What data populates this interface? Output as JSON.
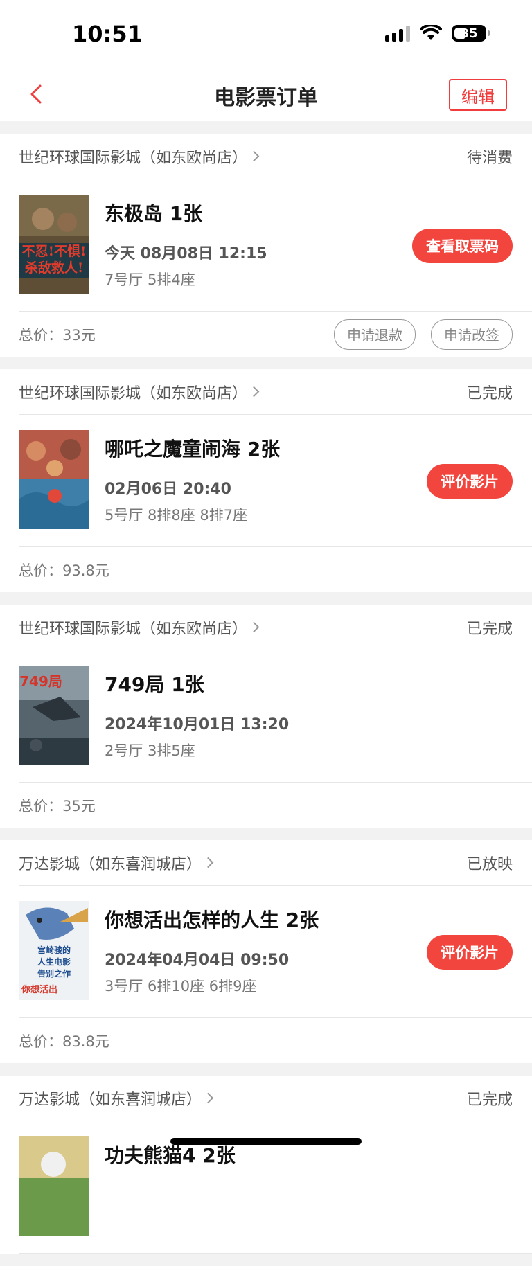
{
  "status_bar": {
    "time": "10:51",
    "battery": "35"
  },
  "nav": {
    "title": "电影票订单",
    "edit_label": "编辑"
  },
  "orders": [
    {
      "cinema": "世纪环球国际影城（如东欧尚店）",
      "status": "待消费",
      "movie": "东极岛 1张",
      "time": "今天 08月08日 12:15",
      "seats": "7号厅 5排4座",
      "action": "查看取票码",
      "total": "总价：33元",
      "refund_label": "申请退款",
      "change_label": "申请改签",
      "poster_colors": [
        "#6b5a3c",
        "#2f4f5a"
      ],
      "poster_text": "不忍！不惧！杀敌救人！"
    },
    {
      "cinema": "世纪环球国际影城（如东欧尚店）",
      "status": "已完成",
      "movie": "哪吒之魔童闹海 2张",
      "time": "02月06日 20:40",
      "seats": "5号厅 8排8座 8排7座",
      "action": "评价影片",
      "total": "总价：93.8元",
      "poster_colors": [
        "#c85b4a",
        "#3a88b5"
      ],
      "poster_text": ""
    },
    {
      "cinema": "世纪环球国际影城（如东欧尚店）",
      "status": "已完成",
      "movie": "749局 1张",
      "time": "2024年10月01日 13:20",
      "seats": "2号厅 3排5座",
      "total": "总价：35元",
      "poster_colors": [
        "#3b4651",
        "#7a8790"
      ],
      "poster_text": "749局"
    },
    {
      "cinema": "万达影城（如东喜润城店）",
      "status": "已放映",
      "movie": "你想活出怎样的人生 2张",
      "time": "2024年04月04日 09:50",
      "seats": "3号厅 6排10座 6排9座",
      "action": "评价影片",
      "total": "总价：83.8元",
      "poster_colors": [
        "#e9eef2",
        "#3b6db3"
      ],
      "poster_text": "宫崎骏的人生电影告别之作"
    },
    {
      "cinema": "万达影城（如东喜润城店）",
      "status": "已完成",
      "movie": "功夫熊猫4 2张",
      "time": "",
      "seats": "",
      "total": "",
      "poster_colors": [
        "#d9c98a",
        "#6a9a4a"
      ],
      "poster_text": ""
    }
  ]
}
